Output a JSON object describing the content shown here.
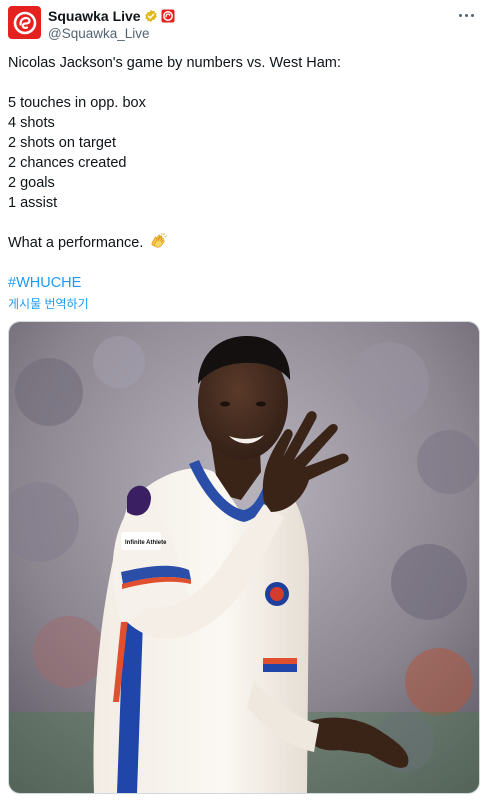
{
  "account": {
    "display_name": "Squawka Live",
    "handle": "@Squawka_Live",
    "avatar_icon": "squawka-logo-icon",
    "verified_icon": "gold-verified-badge-icon",
    "affiliate_icon": "affiliate-badge-icon",
    "brand_color": "#e4211f"
  },
  "menu": {
    "more_icon": "more-options-icon"
  },
  "post": {
    "intro": "Nicolas Jackson's game by numbers vs. West Ham:",
    "stats": [
      "5 touches in opp. box",
      "4 shots",
      "2 shots on target",
      "2 chances created",
      "2 goals",
      "1 assist"
    ],
    "outro": "What a performance.",
    "emoji_icon": "clapping-hands-icon",
    "hashtag": "#WHUCHE",
    "translate_label": "게시물 번역하기"
  },
  "media": {
    "description_icon": "player-photo",
    "sponsor_text": "Infinite Athlete"
  },
  "colors": {
    "link": "#1d9bf0",
    "text": "#0f1419",
    "muted": "#536471"
  }
}
